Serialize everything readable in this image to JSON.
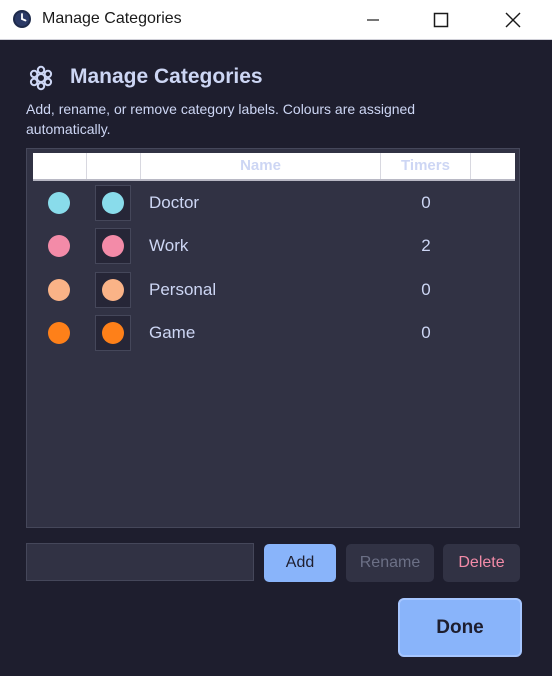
{
  "window": {
    "title": "Manage Categories",
    "icon": "clock-icon"
  },
  "header": {
    "icon": "gear-icon",
    "title": "Manage Categories",
    "description": "Add, rename, or remove category labels. Colours are assigned automatically."
  },
  "table": {
    "columns": [
      "",
      "",
      "Name",
      "Timers",
      ""
    ],
    "rows": [
      {
        "color": "#89dceb",
        "name": "Doctor",
        "timers": "0"
      },
      {
        "color": "#f38ba8",
        "name": "Work",
        "timers": "2"
      },
      {
        "color": "#fab387",
        "name": "Personal",
        "timers": "0"
      },
      {
        "color": "#fe8019",
        "name": "Game",
        "timers": "0"
      }
    ]
  },
  "controls": {
    "input_value": "",
    "input_placeholder": "",
    "add_label": "Add",
    "rename_label": "Rename",
    "delete_label": "Delete",
    "done_label": "Done"
  },
  "colors": {
    "background": "#1e1e2e",
    "accent": "#89b4fa",
    "text": "#cdd6f4",
    "danger": "#f38ba8"
  }
}
